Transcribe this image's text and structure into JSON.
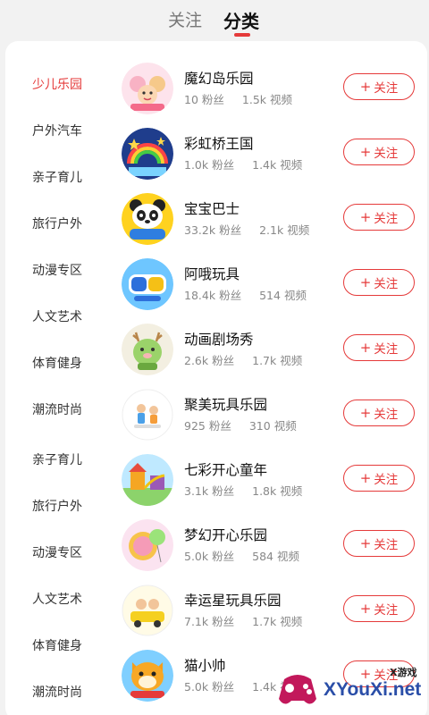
{
  "tabs": {
    "follow_label": "关注",
    "category_label": "分类"
  },
  "sidebar": {
    "items": [
      {
        "label": "少儿乐园",
        "active": true
      },
      {
        "label": "户外汽车"
      },
      {
        "label": "亲子育儿"
      },
      {
        "label": "旅行户外"
      },
      {
        "label": "动漫专区"
      },
      {
        "label": "人文艺术"
      },
      {
        "label": "体育健身"
      },
      {
        "label": "潮流时尚"
      },
      {
        "label": "亲子育儿"
      },
      {
        "label": "旅行户外"
      },
      {
        "label": "动漫专区"
      },
      {
        "label": "人文艺术"
      },
      {
        "label": "体育健身"
      },
      {
        "label": "潮流时尚"
      }
    ]
  },
  "channels": [
    {
      "name": "魔幻岛乐园",
      "fans": "10",
      "videos": "1.5k",
      "avatar_icon": "cartoon-kids-avatar-icon"
    },
    {
      "name": "彩虹桥王国",
      "fans": "1.0k",
      "videos": "1.4k",
      "avatar_icon": "rainbow-stars-avatar-icon"
    },
    {
      "name": "宝宝巴士",
      "fans": "33.2k",
      "videos": "2.1k",
      "avatar_icon": "panda-bus-avatar-icon"
    },
    {
      "name": "阿哦玩具",
      "fans": "18.4k",
      "videos": "514",
      "avatar_icon": "toy-logo-avatar-icon"
    },
    {
      "name": "动画剧场秀",
      "fans": "2.6k",
      "videos": "1.7k",
      "avatar_icon": "green-deer-avatar-icon"
    },
    {
      "name": "聚美玩具乐园",
      "fans": "925",
      "videos": "310",
      "avatar_icon": "two-kids-avatar-icon"
    },
    {
      "name": "七彩开心童年",
      "fans": "3.1k",
      "videos": "1.8k",
      "avatar_icon": "playground-avatar-icon"
    },
    {
      "name": "梦幻开心乐园",
      "fans": "5.0k",
      "videos": "584",
      "avatar_icon": "balloon-avatar-icon"
    },
    {
      "name": "幸运星玩具乐园",
      "fans": "7.1k",
      "videos": "1.7k",
      "avatar_icon": "kids-car-avatar-icon"
    },
    {
      "name": "猫小帅",
      "fans": "5.0k",
      "videos": "1.4k",
      "avatar_icon": "tiger-cat-avatar-icon"
    }
  ],
  "labels": {
    "fans_unit": "粉丝",
    "videos_unit": "视频",
    "follow_button": "关注",
    "plus_icon": "plus-icon"
  },
  "watermark": {
    "small_text": "X游戏",
    "big_text": "XYouXi.net"
  },
  "colors": {
    "accent": "#e53a3a",
    "background": "#f2f2f2",
    "panel": "#ffffff"
  }
}
